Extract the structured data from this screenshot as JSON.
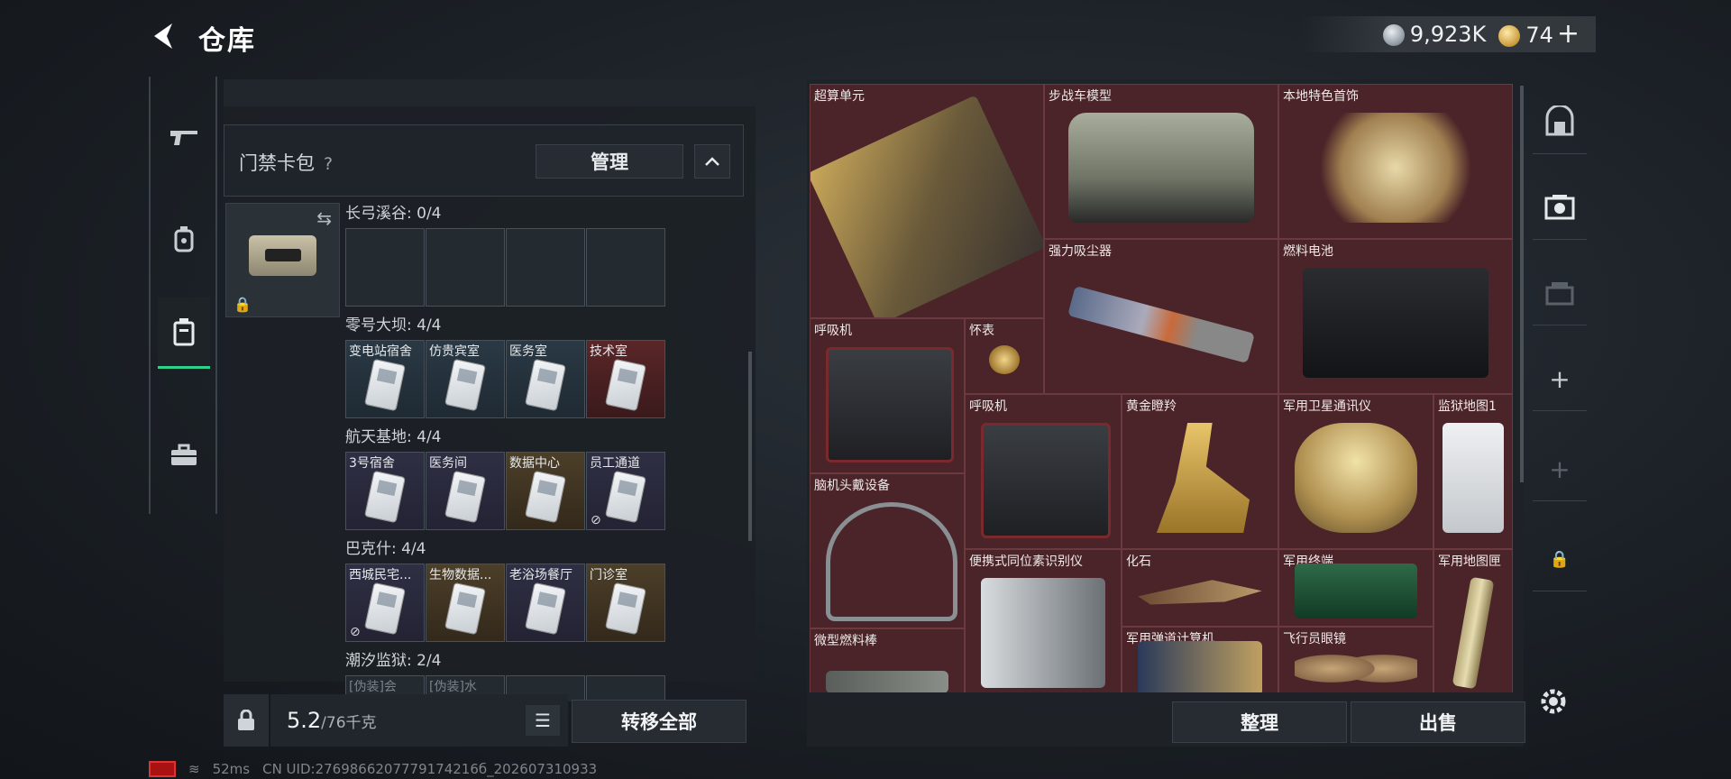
{
  "header": {
    "title": "仓库",
    "silver_amount": "9,923K",
    "gold_amount": "74"
  },
  "card_pack": {
    "label": "门禁卡包",
    "manage_label": "管理"
  },
  "groups": [
    {
      "label": "长弓溪谷: 0/4",
      "slots": [
        {
          "name": "",
          "color": "empty"
        },
        {
          "name": "",
          "color": "empty"
        },
        {
          "name": "",
          "color": "empty"
        },
        {
          "name": "",
          "color": "empty"
        }
      ]
    },
    {
      "label": "零号大坝: 4/4",
      "slots": [
        {
          "name": "变电站宿舍",
          "color": "blue"
        },
        {
          "name": "仿贵宾室",
          "color": "blue"
        },
        {
          "name": "医务室",
          "color": "blue"
        },
        {
          "name": "技术室",
          "color": "red"
        }
      ]
    },
    {
      "label": "航天基地: 4/4",
      "slots": [
        {
          "name": "3号宿舍",
          "color": "purple"
        },
        {
          "name": "医务间",
          "color": "purple"
        },
        {
          "name": "数据中心",
          "color": "gold"
        },
        {
          "name": "员工通道",
          "color": "purple"
        }
      ]
    },
    {
      "label": "巴克什: 4/4",
      "slots": [
        {
          "name": "西城民宅...",
          "color": "purple"
        },
        {
          "name": "生物数据...",
          "color": "gold"
        },
        {
          "name": "老浴场餐厅",
          "color": "purple"
        },
        {
          "name": "门诊室",
          "color": "gold"
        }
      ]
    },
    {
      "label": "潮汐监狱: 2/4",
      "slots": [
        {
          "name": "[伪装]会",
          "color": "empty"
        },
        {
          "name": "[伪装]水",
          "color": "empty"
        }
      ]
    }
  ],
  "weight": {
    "current": "5.2",
    "max": "/76千克"
  },
  "buttons": {
    "transfer_all": "转移全部",
    "sort": "整理",
    "sell": "出售"
  },
  "items": [
    {
      "name": "超算单元",
      "art": "tech"
    },
    {
      "name": "步战车模型",
      "art": "tank"
    },
    {
      "name": "本地特色首饰",
      "art": "jewel"
    },
    {
      "name": "强力吸尘器",
      "art": "vac"
    },
    {
      "name": "燃料电池",
      "art": "batt"
    },
    {
      "name": "呼吸机",
      "art": "resp"
    },
    {
      "name": "怀表",
      "art": "watch"
    },
    {
      "name": "呼吸机",
      "art": "resp"
    },
    {
      "name": "黄金瞪羚",
      "art": "deer"
    },
    {
      "name": "军用卫星通讯仪",
      "art": "sat"
    },
    {
      "name": "监狱地图1",
      "art": "map"
    },
    {
      "name": "脑机头戴设备",
      "art": "head"
    },
    {
      "name": "便携式同位素识别仪",
      "art": "gun"
    },
    {
      "name": "化石",
      "art": "fossil"
    },
    {
      "name": "军用终端",
      "art": "radio"
    },
    {
      "name": "军用地图匣",
      "art": "tube"
    },
    {
      "name": "微型燃料棒",
      "art": "rod"
    },
    {
      "name": "军用弹道计算机",
      "art": "calc"
    },
    {
      "name": "飞行员眼镜",
      "art": "glass"
    }
  ],
  "status": {
    "ping": "52ms",
    "uid": "CN UID:2769866207779174216б_202607310933"
  }
}
